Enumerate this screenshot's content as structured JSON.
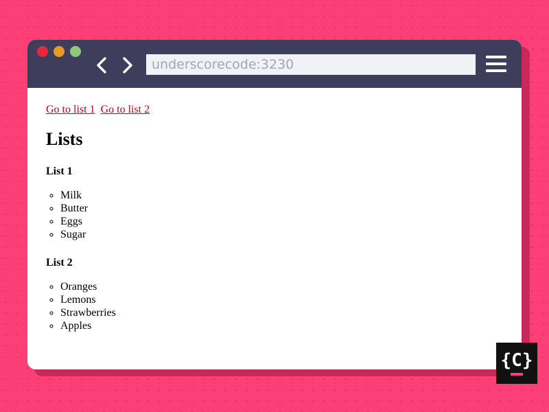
{
  "browser": {
    "address": "underscorecode:3230",
    "controls": [
      "close-dot",
      "minimize-dot",
      "maximize-dot"
    ],
    "nav_icons": [
      "chevron-left-icon",
      "chevron-right-icon",
      "hamburger-menu-icon"
    ]
  },
  "page": {
    "links": [
      "Go to list 1",
      "Go to list 2"
    ],
    "heading": "Lists",
    "lists": [
      {
        "title": "List 1",
        "items": [
          "Milk",
          "Butter",
          "Eggs",
          "Sugar"
        ]
      },
      {
        "title": "List 2",
        "items": [
          "Oranges",
          "Lemons",
          "Strawberries",
          "Apples"
        ]
      }
    ]
  },
  "logo": {
    "text": "{C}",
    "accent": "#fd3f77"
  },
  "colors": {
    "background": "#fd3f77",
    "titlebar": "#3e3d5c",
    "link": "#bb0022"
  }
}
